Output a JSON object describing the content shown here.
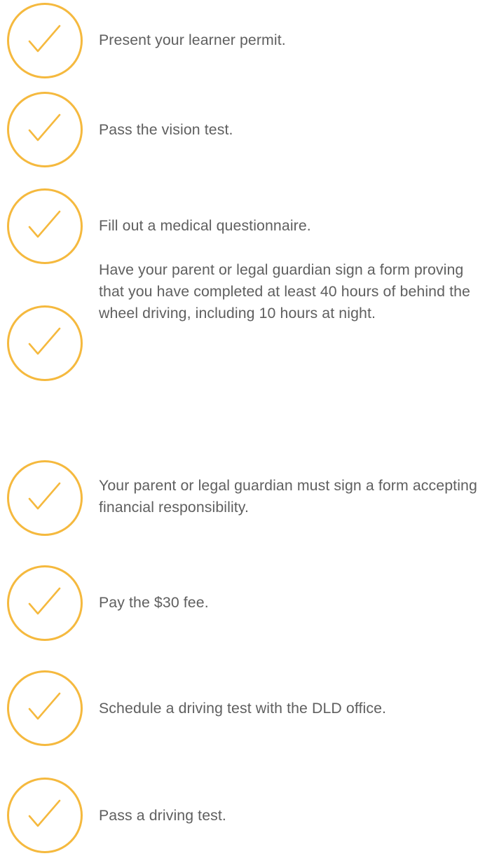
{
  "colors": {
    "accent": "#f5b93e",
    "text": "#5f5f5f",
    "background": "#ffffff"
  },
  "checklist": {
    "icon": "check-circle-icon",
    "items": [
      {
        "text": "Present your learner permit."
      },
      {
        "text": "Pass the vision test."
      },
      {
        "text": "Fill out a medical questionnaire."
      },
      {
        "text": "Have your parent or legal guardian sign a form proving that you have completed at least 40 hours of behind the wheel driving, including 10 hours at night."
      },
      {
        "text": "Your parent or legal guardian must sign a form accepting financial responsibility."
      },
      {
        "text": "Pay the $30 fee."
      },
      {
        "text": "Schedule a driving test with the DLD office."
      },
      {
        "text": "Pass a driving test."
      }
    ]
  }
}
